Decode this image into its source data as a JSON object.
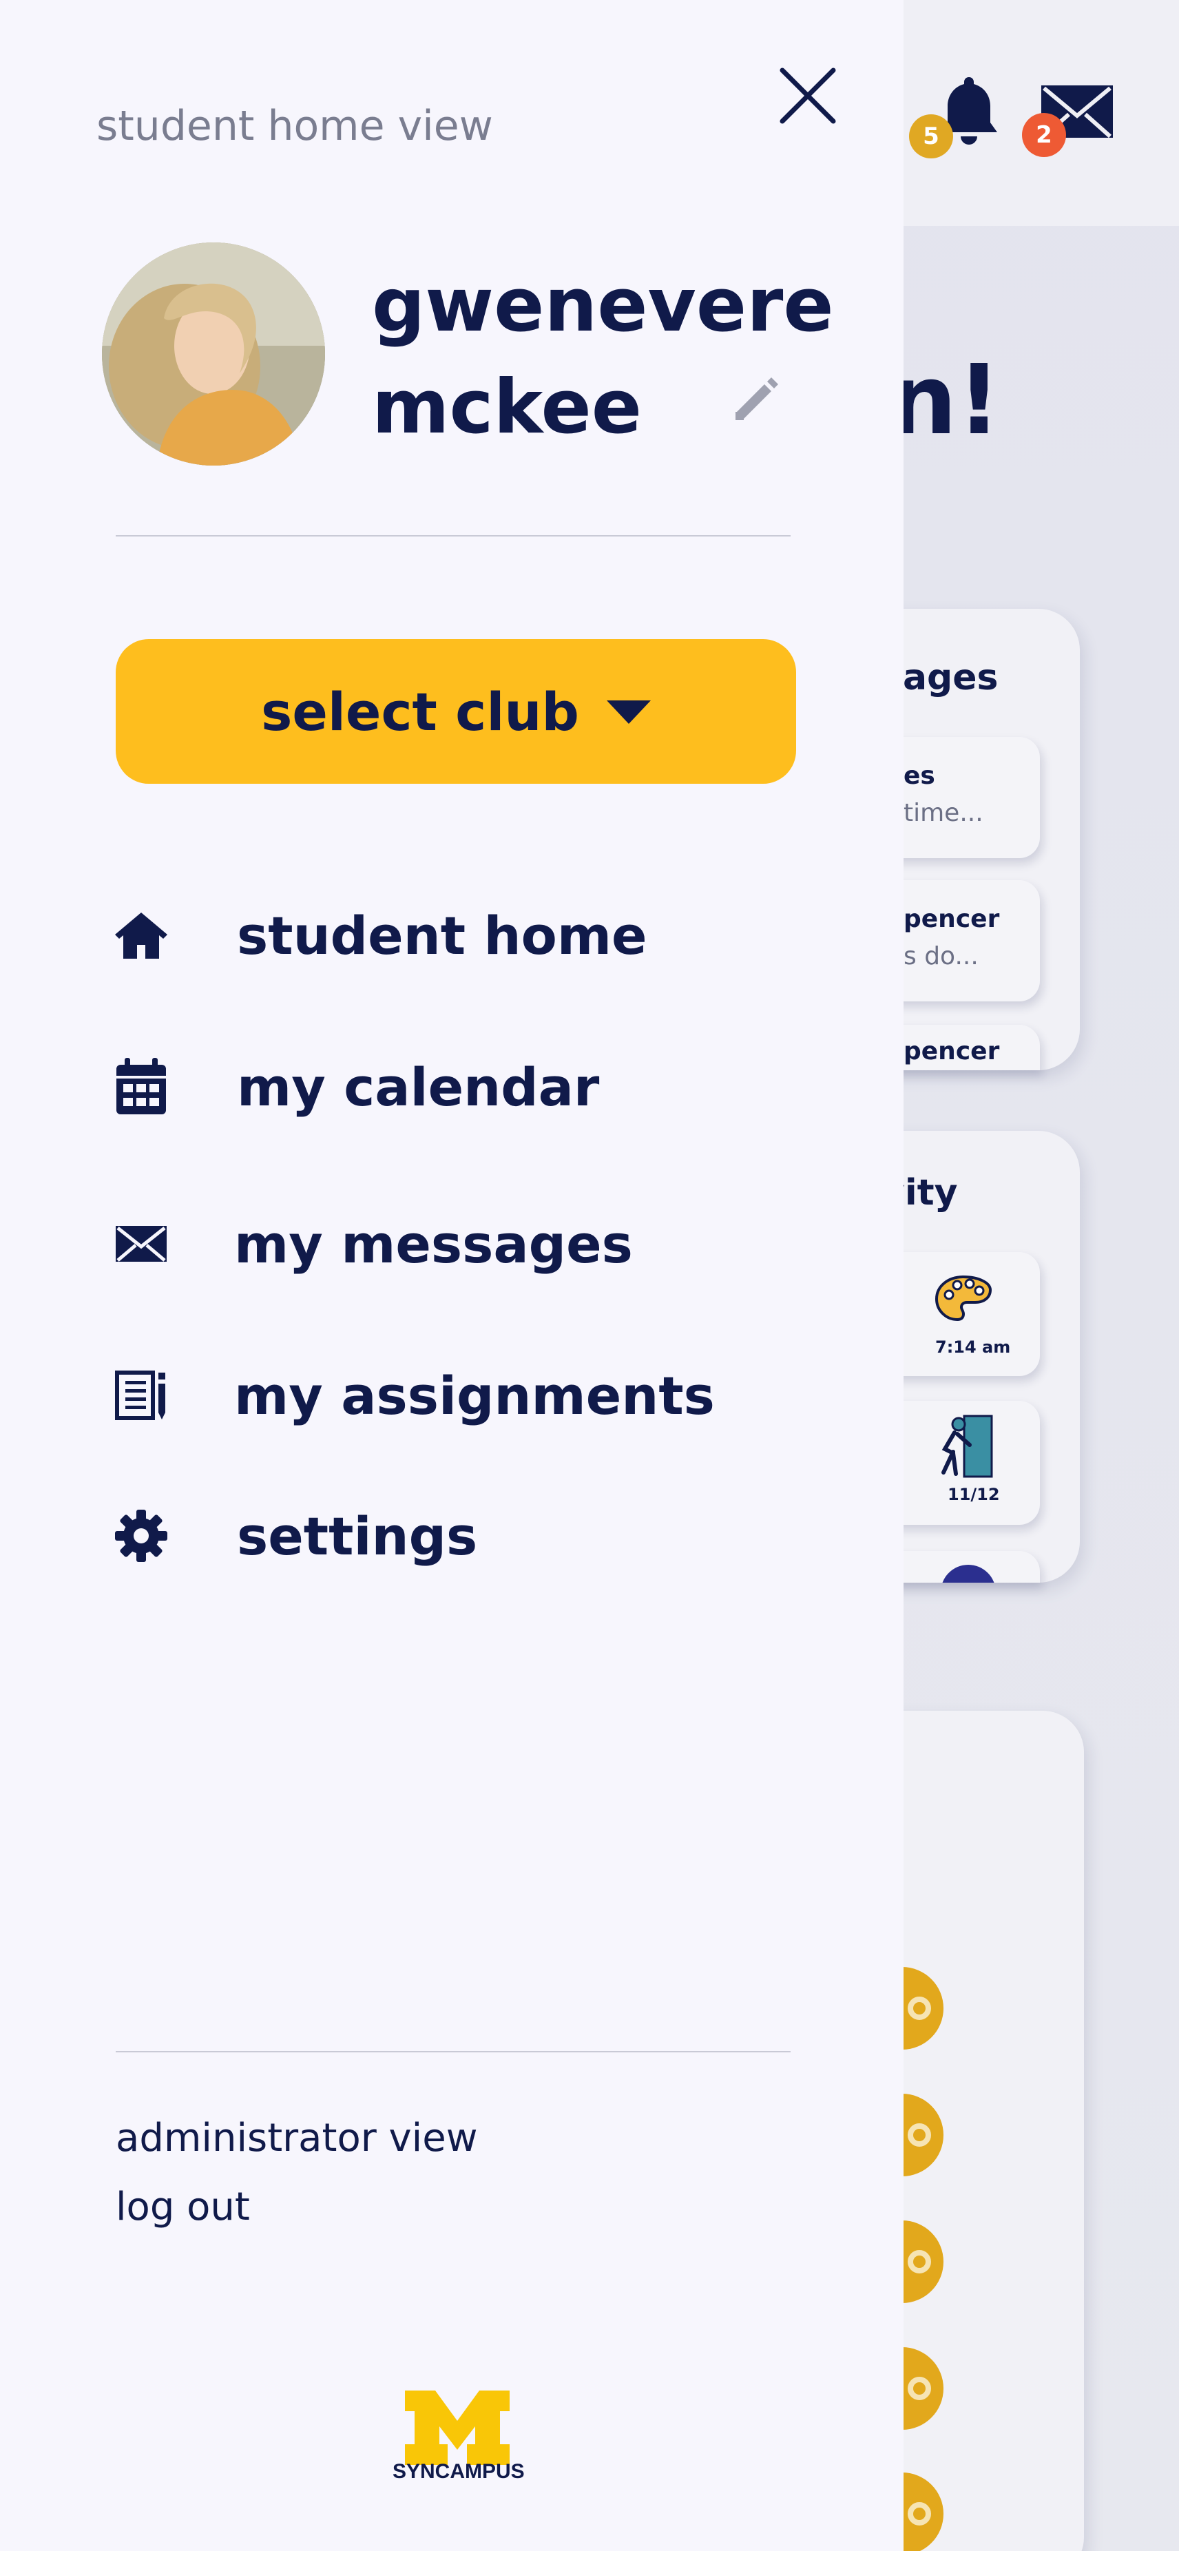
{
  "colors": {
    "drawer_bg": "#f7f6fd",
    "navy": "#101a4a",
    "accent_yellow": "#febe1e",
    "muted_text": "#7a7d90",
    "notif_badge": "#e0a823",
    "msg_badge": "#ee5a34"
  },
  "background": {
    "notification_count": "5",
    "message_count": "2",
    "greeting_fragment": "n!",
    "messages_card": {
      "title_fragment": "sages",
      "items": [
        {
          "title": "es",
          "snippet": "time..."
        },
        {
          "title": "pencer",
          "snippet": "s do..."
        },
        {
          "title": "pencer"
        }
      ]
    },
    "activity_card": {
      "title_fragment": "vity",
      "items": [
        {
          "icon": "palette-icon",
          "label": "7:14 am"
        },
        {
          "icon": "climbing-icon",
          "label": "11/12"
        },
        {
          "icon": "mascot-icon"
        }
      ]
    }
  },
  "drawer": {
    "view_label": "student home view",
    "close_label": "close menu",
    "user": {
      "first_name": "gwenevere",
      "last_name": "mckee"
    },
    "select_club_label": "select club",
    "nav": [
      {
        "icon": "home-icon",
        "label": "student home"
      },
      {
        "icon": "calendar-icon",
        "label": "my calendar"
      },
      {
        "icon": "envelope-icon",
        "label": "my messages"
      },
      {
        "icon": "assignments-icon",
        "label": "my assignments"
      },
      {
        "icon": "gear-icon",
        "label": "settings"
      }
    ],
    "footer": {
      "admin_label": "administrator view",
      "logout_label": "log out"
    },
    "brand": {
      "logo_letter": "M",
      "logo_text": "SYNCAMPUS"
    }
  }
}
